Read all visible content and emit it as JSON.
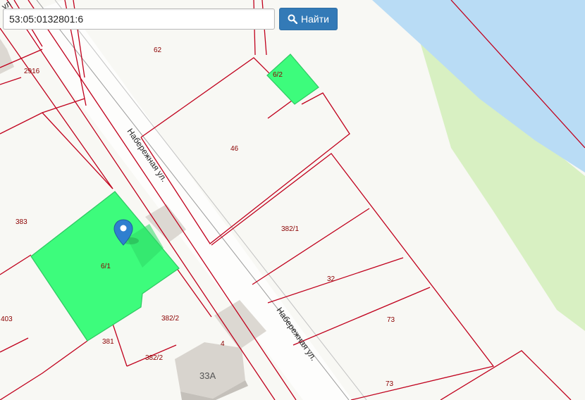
{
  "search": {
    "value": "53:05:0132801:6",
    "button_label": "Найти",
    "button_icon": "search-icon"
  },
  "map": {
    "colors": {
      "water": "#b9dcf5",
      "shore_green": "#d8f0c2",
      "plot_border": "#c0001c",
      "selected_fill": "#3dfc7c",
      "selected_border": "#2ec862",
      "building": "#dcd8d2"
    },
    "street_labels": [
      "Набережная ул.",
      "Набережная ул.",
      "ул"
    ],
    "plot_labels": {
      "p62": "62",
      "p2916": "2916",
      "p6_2": "6/2",
      "p46": "46",
      "p383": "383",
      "p6_1": "6/1",
      "p382_1": "382/1",
      "p32": "32",
      "p403": "403",
      "p382_2a": "382/2",
      "p73a": "73",
      "p381": "381",
      "p382_2b": "382/2",
      "p4": "4",
      "p73b": "73"
    },
    "building_label": "33А",
    "marker_icon": "map-marker-icon"
  }
}
